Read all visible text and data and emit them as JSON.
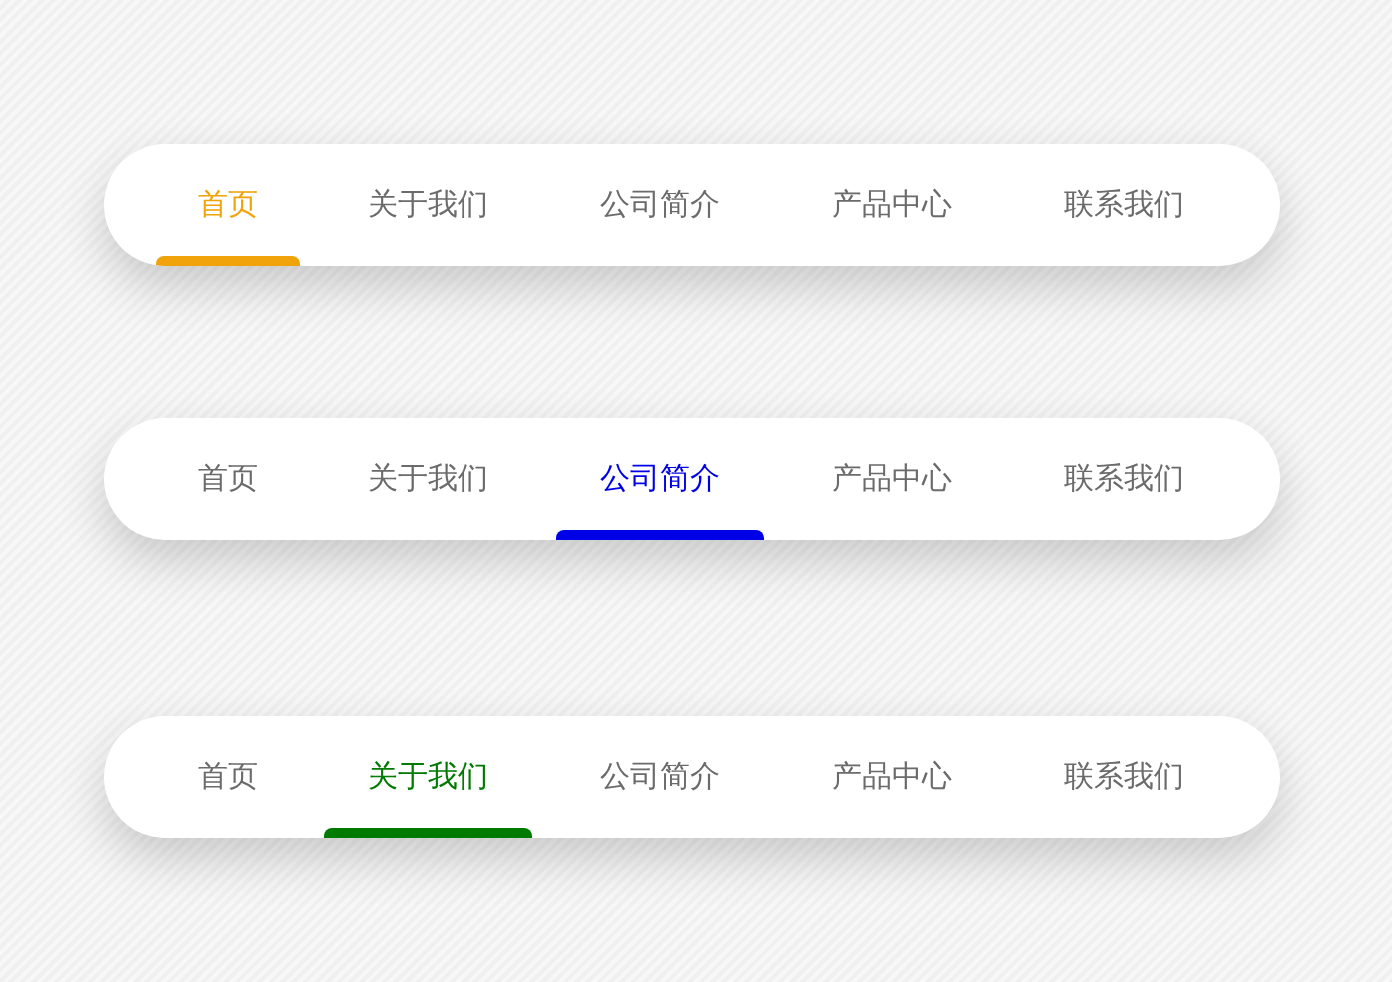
{
  "nav_bars": [
    {
      "color": "#f0a30a",
      "tabs": [
        {
          "label": "首页",
          "selected": true
        },
        {
          "label": "关于我们",
          "selected": false
        },
        {
          "label": "公司简介",
          "selected": false
        },
        {
          "label": "产品中心",
          "selected": false
        },
        {
          "label": "联系我们",
          "selected": false
        }
      ]
    },
    {
      "color": "#0000e6",
      "tabs": [
        {
          "label": "首页",
          "selected": false
        },
        {
          "label": "关于我们",
          "selected": false
        },
        {
          "label": "公司简介",
          "selected": true
        },
        {
          "label": "产品中心",
          "selected": false
        },
        {
          "label": "联系我们",
          "selected": false
        }
      ]
    },
    {
      "color": "#007a00",
      "tabs": [
        {
          "label": "首页",
          "selected": false
        },
        {
          "label": "关于我们",
          "selected": true
        },
        {
          "label": "公司简介",
          "selected": false
        },
        {
          "label": "产品中心",
          "selected": false
        },
        {
          "label": "联系我们",
          "selected": false
        }
      ]
    }
  ]
}
